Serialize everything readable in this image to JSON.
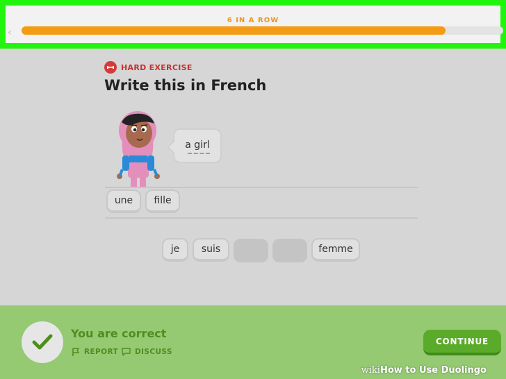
{
  "header": {
    "streak_label": "6 IN A ROW",
    "progress_fraction": 0.88
  },
  "exercise": {
    "badge_label": "HARD EXERCISE",
    "title": "Write this in French",
    "prompt_text": "a girl"
  },
  "answer": {
    "tiles": [
      "une",
      "fille"
    ]
  },
  "word_bank": {
    "tiles": [
      "je",
      "suis",
      "",
      "",
      "femme"
    ]
  },
  "feedback": {
    "status": "You are correct",
    "report_label": "REPORT",
    "discuss_label": "DISCUSS",
    "continue_label": "CONTINUE"
  },
  "watermark": {
    "brand": "wiki",
    "text": "How to Use Duolingo"
  },
  "colors": {
    "accent_orange": "#f39b15",
    "success_green": "#5bab2a",
    "highlight_frame": "#21f50d",
    "badge_red": "#d63a3a"
  },
  "icons": {
    "badge": "dumbbell-icon",
    "check": "checkmark-icon",
    "report": "flag-icon",
    "discuss": "speech-bubble-icon",
    "back": "chevron-left-icon"
  }
}
